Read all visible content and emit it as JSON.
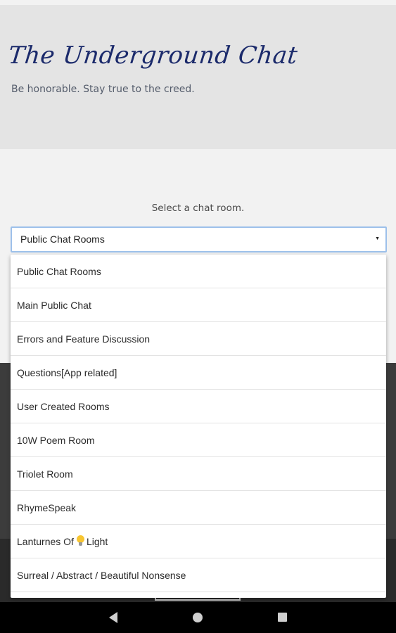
{
  "header": {
    "title": "The Underground Chat",
    "subtitle": "Be honorable. Stay true to the creed."
  },
  "room_picker": {
    "prompt": "Select a chat room.",
    "selected": "Public Chat Rooms",
    "options": [
      "Public Chat Rooms",
      "Main Public Chat",
      "Errors and Feature Discussion",
      "Questions[App related]",
      "User Created Rooms",
      "10W Poem Room",
      "Triolet Room",
      "RhymeSpeak",
      "Lanturnes Of",
      "Surreal / Abstract / Beautiful Nonsense"
    ],
    "option_9_suffix": "Light",
    "option_9_icon": "lightbulb-icon"
  },
  "nav": {
    "back_icon": "back-icon",
    "home_icon": "home-icon",
    "recents_icon": "recents-icon"
  },
  "colors": {
    "title": "#1b2a6b",
    "header_bg": "#e4e4e4",
    "select_border": "#9dc0ea"
  }
}
